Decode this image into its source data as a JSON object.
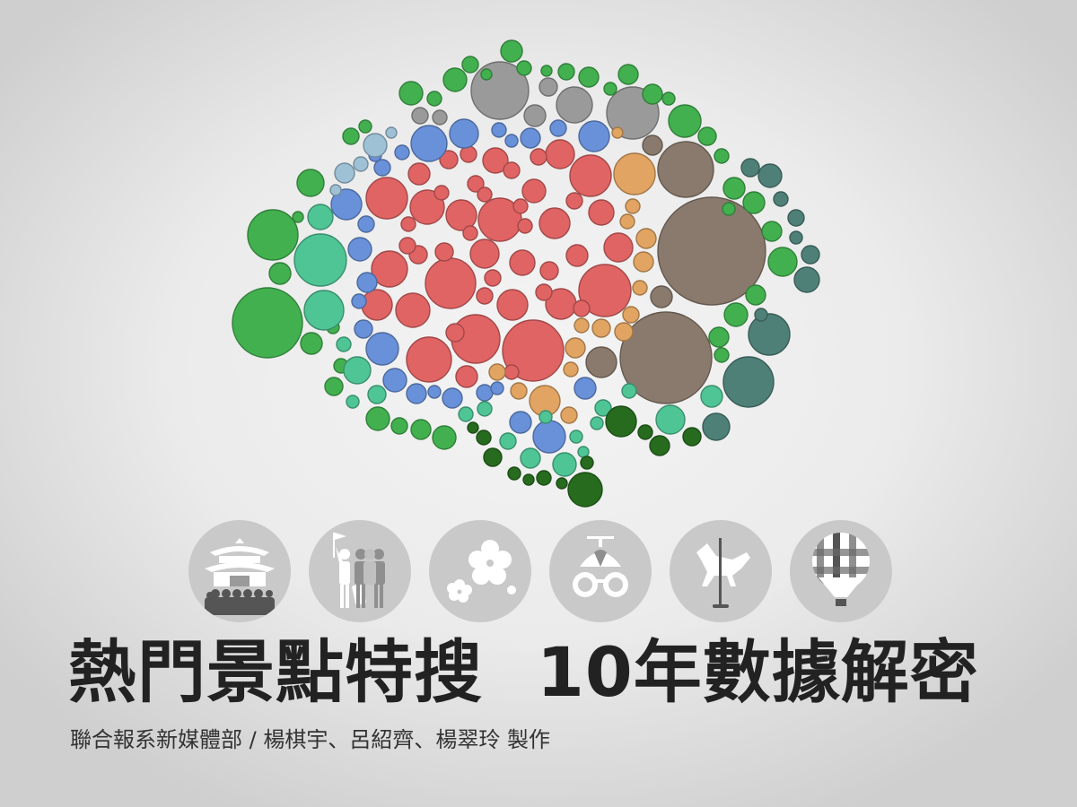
{
  "title_left": "熱門景點特搜",
  "title_right": "10年數據解密",
  "credit": "聯合報系新媒體部 / 楊棋宇、呂紹齊、楊翠玲  製作",
  "colors": {
    "red": "#e06464",
    "blue": "#6991d9",
    "lightblue": "#9fc1d6",
    "orange": "#e1a462",
    "grey": "#9a9a9a",
    "brown": "#8a7a6d",
    "green": "#42b04f",
    "mint": "#4fc596",
    "teal": "#4e8078",
    "darkgreen": "#276b1e",
    "icon_bg": "#c9c9c9"
  },
  "icons": [
    {
      "name": "temple-icon"
    },
    {
      "name": "tourists-icon"
    },
    {
      "name": "cherry-blossom-icon"
    },
    {
      "name": "propeller-cap-glasses-icon"
    },
    {
      "name": "carousel-horse-icon"
    },
    {
      "name": "hot-air-balloon-icon"
    }
  ]
}
